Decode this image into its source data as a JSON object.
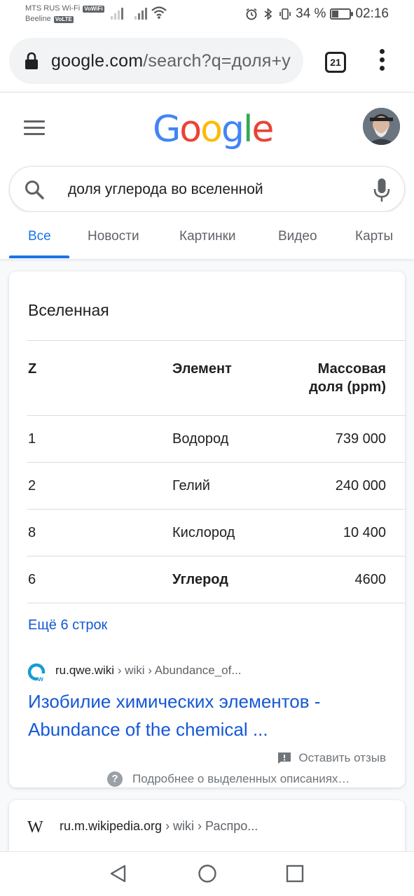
{
  "status_bar": {
    "carrier_1": "MTS RUS Wi-Fi",
    "carrier_1_badge": "VoWiFi",
    "carrier_2": "Beeline",
    "carrier_2_badge": "VoLTE",
    "battery_percent": "34 %",
    "battery_level": 0.34,
    "time": "02:16"
  },
  "browser": {
    "url_host": "google.com",
    "url_path": "/search?q=доля+у",
    "tab_count": "21"
  },
  "google": {
    "logo": [
      "G",
      "o",
      "o",
      "g",
      "l",
      "e"
    ],
    "logo_colors": [
      "#4285F4",
      "#EA4335",
      "#FBBC05",
      "#4285F4",
      "#34A853",
      "#EA4335"
    ],
    "search_query": "доля углерода во вселенной",
    "tabs": [
      {
        "label": "Все",
        "active": true
      },
      {
        "label": "Новости",
        "active": false
      },
      {
        "label": "Картинки",
        "active": false
      },
      {
        "label": "Видео",
        "active": false
      },
      {
        "label": "Карты",
        "active": false
      }
    ]
  },
  "snippet": {
    "title": "Вселенная",
    "headers": {
      "z": "Z",
      "element": "Элемент",
      "mass_line1": "Массовая",
      "mass_line2": "доля (ppm)"
    },
    "rows": [
      {
        "z": "1",
        "element": "Водород",
        "value": "739 000"
      },
      {
        "z": "2",
        "element": "Гелий",
        "value": "240 000"
      },
      {
        "z": "8",
        "element": "Кислород",
        "value": "10 400"
      },
      {
        "z": "6",
        "element": "Углерод",
        "value": "4600"
      }
    ],
    "more_rows": "Ещё 6 строк",
    "source_host": "ru.qwe.wiki",
    "source_path": " › wiki › Abundance_of...",
    "result_title": "Изобилие химических элементов - Abundance of the chemical ...",
    "feedback": "Оставить отзыв",
    "about": "Подробнее о выделенных описаниях…"
  },
  "second_result": {
    "source_host": "ru.m.wikipedia.org",
    "source_path": " › wiki › Распро...",
    "icon_text": "W"
  },
  "colors": {
    "accent": "#1a73e8",
    "link": "#1558d6"
  }
}
